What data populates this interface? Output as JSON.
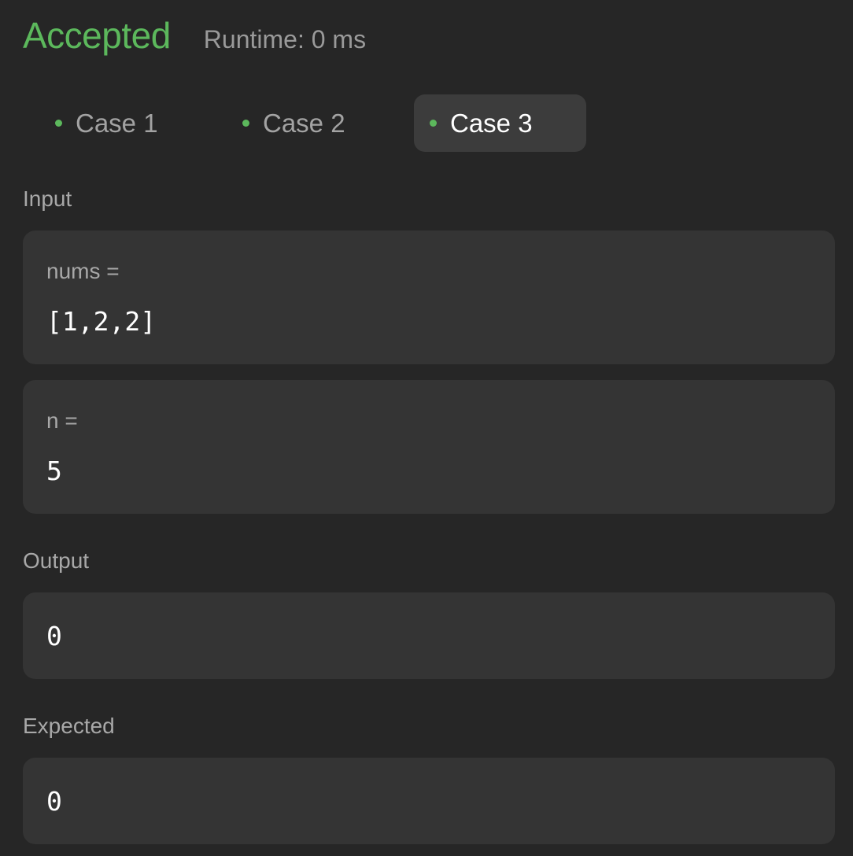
{
  "result": {
    "status": "Accepted",
    "runtime": "Runtime: 0 ms"
  },
  "tabs": [
    {
      "label": "Case 1",
      "active": false
    },
    {
      "label": "Case 2",
      "active": false
    },
    {
      "label": "Case 3",
      "active": true
    }
  ],
  "input": {
    "label": "Input",
    "params": [
      {
        "name": "nums =",
        "value": "[1,2,2]"
      },
      {
        "name": "n =",
        "value": "5"
      }
    ]
  },
  "output": {
    "label": "Output",
    "value": "0"
  },
  "expected": {
    "label": "Expected",
    "value": "0"
  },
  "colors": {
    "background": "#262626",
    "panel": "#343434",
    "accent_green": "#5cb85c",
    "active_tab": "#3c3c3c"
  }
}
